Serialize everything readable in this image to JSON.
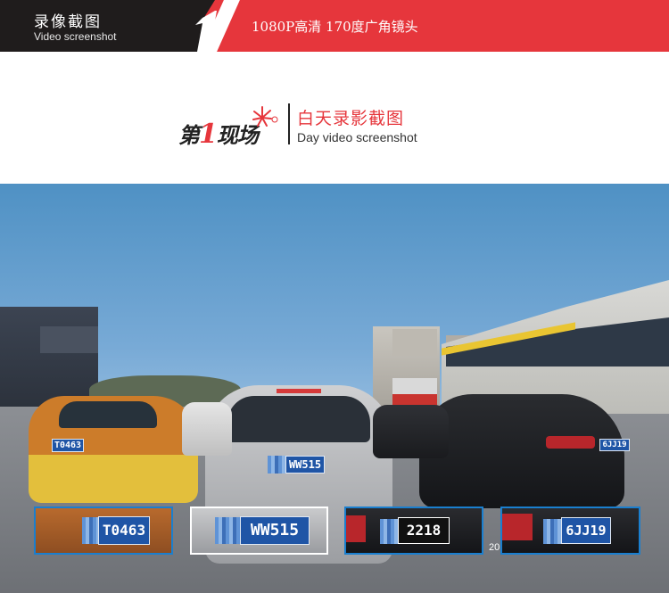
{
  "banner": {
    "title_cn": "录像截图",
    "title_en": "Video screenshot",
    "spec": "1080P高清  170度广角镜头"
  },
  "logo": {
    "brand_prefix": "第",
    "brand_number": "1",
    "brand_suffix": "现场",
    "section_title_cn": "白天录影截图",
    "section_title_en": "Day video screenshot"
  },
  "scene": {
    "plates": {
      "taxi": "T0463",
      "center_car": "WW515",
      "black_car": "6JJ19"
    },
    "zoom_thumbnails": [
      {
        "plate": "T0463"
      },
      {
        "plate": "WW515"
      },
      {
        "plate": "2218"
      },
      {
        "plate": "6JJ19"
      }
    ],
    "timestamp": "20"
  },
  "colors": {
    "banner_red": "#e6363c",
    "banner_dark": "#1f1c1c",
    "thumb_border": "#1a7fcf",
    "plate_blue": "#1f55a6"
  }
}
